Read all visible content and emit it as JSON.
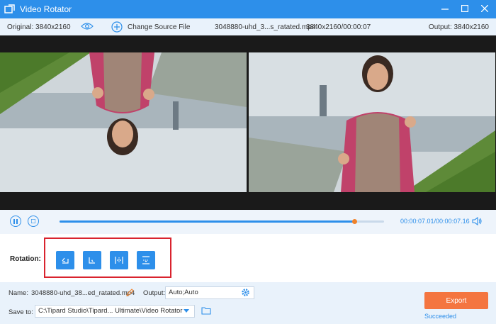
{
  "window": {
    "title": "Video Rotator"
  },
  "infobar": {
    "original": "Original: 3840x2160",
    "change_source": "Change Source File",
    "file_name": "3048880-uhd_3...s_ratated.mp4",
    "file_resolution": "3840x2160/00:00:07",
    "output": "Output: 3840x2160"
  },
  "playback": {
    "current_time": "00:00:07.01",
    "total_time": "/00:00:07.16",
    "progress_fraction": 0.91
  },
  "rotation": {
    "label": "Rotation:",
    "buttons": [
      "rotate-left",
      "rotate-right",
      "flip-horizontal",
      "flip-vertical"
    ]
  },
  "bottom": {
    "name_label": "Name:",
    "name_value": "3048880-uhd_38...ed_ratated.mp4",
    "output_label": "Output:",
    "output_value": "Auto;Auto",
    "save_label": "Save to:",
    "save_value": "C:\\Tipard Studio\\Tipard... Ultimate\\Video Rotator",
    "export_label": "Export",
    "status": "Succeeded"
  },
  "colors": {
    "accent": "#2d8fea",
    "export": "#f47540",
    "highlight": "#d9232e"
  }
}
